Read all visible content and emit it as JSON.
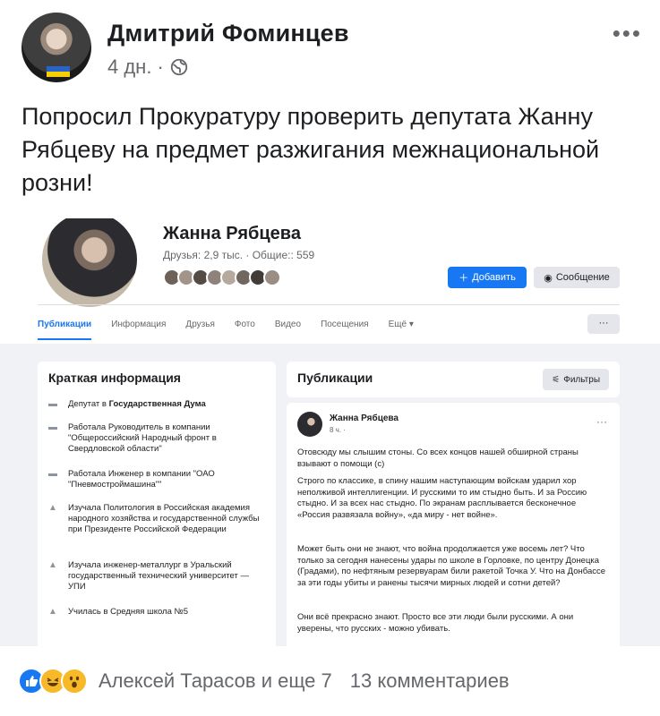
{
  "post": {
    "author": "Дмитрий Фоминцев",
    "time": "4 дн.",
    "separator": "·",
    "text": "Попросил Прокуратуру проверить депутата Жанну Рябцеву на предмет разжигания межнациональной розни!"
  },
  "embedded": {
    "profile_name": "Жанна Рябцева",
    "friends_line": "Друзья: 2,9 тыс. · Общие:: 559",
    "add_button": "Добавить",
    "message_button": "Сообщение",
    "tabs": [
      "Публикации",
      "Информация",
      "Друзья",
      "Фото",
      "Видео",
      "Посещения",
      "Ещё ▾"
    ],
    "tabs_more": "···",
    "intro_title": "Краткая информация",
    "intro_items": [
      {
        "text_pre": "Депутат в ",
        "text_bold": "Государственная Дума"
      },
      {
        "text_pre": "Работала Руководитель в компании \"Общероссийский Народный фронт в Свердловской области\"",
        "text_bold": ""
      },
      {
        "text_pre": "Работала Инженер в компании \"ОАО \"Пневмостроймашина\"\"",
        "text_bold": ""
      },
      {
        "text_pre": "Изучала Политология в Российская академия народного хозяйства и государственной службы при Президенте Российской Федерации",
        "text_bold": ""
      },
      {
        "text_pre": "Изучала инженер-металлург в Уральский государственный технический университет — УПИ",
        "text_bold": ""
      },
      {
        "text_pre": "Училась в Средняя школа №5",
        "text_bold": ""
      }
    ],
    "pubs_title": "Публикации",
    "filters_label": "Фильтры",
    "mini_post": {
      "author": "Жанна Рябцева",
      "meta": "8 ч. ·",
      "p1": "Отовсюду мы слышим стоны. Со всех концов нашей обширной страны взывают о помощи (с)",
      "p2": "Строго по классике, в спину нашим наступающим войскам ударил хор неполживой интеллигенции. И русскими то им стыдно быть. И за Россию стыдно. И за всех нас стыдно. По экранам расплывается бесконечное «Россия развязала войну», «да миру - нет войне».",
      "p3": "Может быть они не знают, что война продолжается уже восемь лет? Что только за сегодня нанесены удары по школе в Горловке, по центру Донецка (Градами), по нефтяным резервуарам били ракетой Точка У. Что на Донбассе за эти годы убиты и ранены тысячи мирных людей и сотни детей?",
      "p4": "Они всё прекрасно знают. Просто все эти люди были русскими. А они уверены, что русских - можно убивать."
    }
  },
  "footer": {
    "reactions_text": "Алексей Тарасов и еще 7",
    "comments_text": "13 комментариев"
  },
  "colors": {
    "accent": "#1877f2",
    "secondary_text": "#65676b",
    "background": "#f0f2f5"
  }
}
